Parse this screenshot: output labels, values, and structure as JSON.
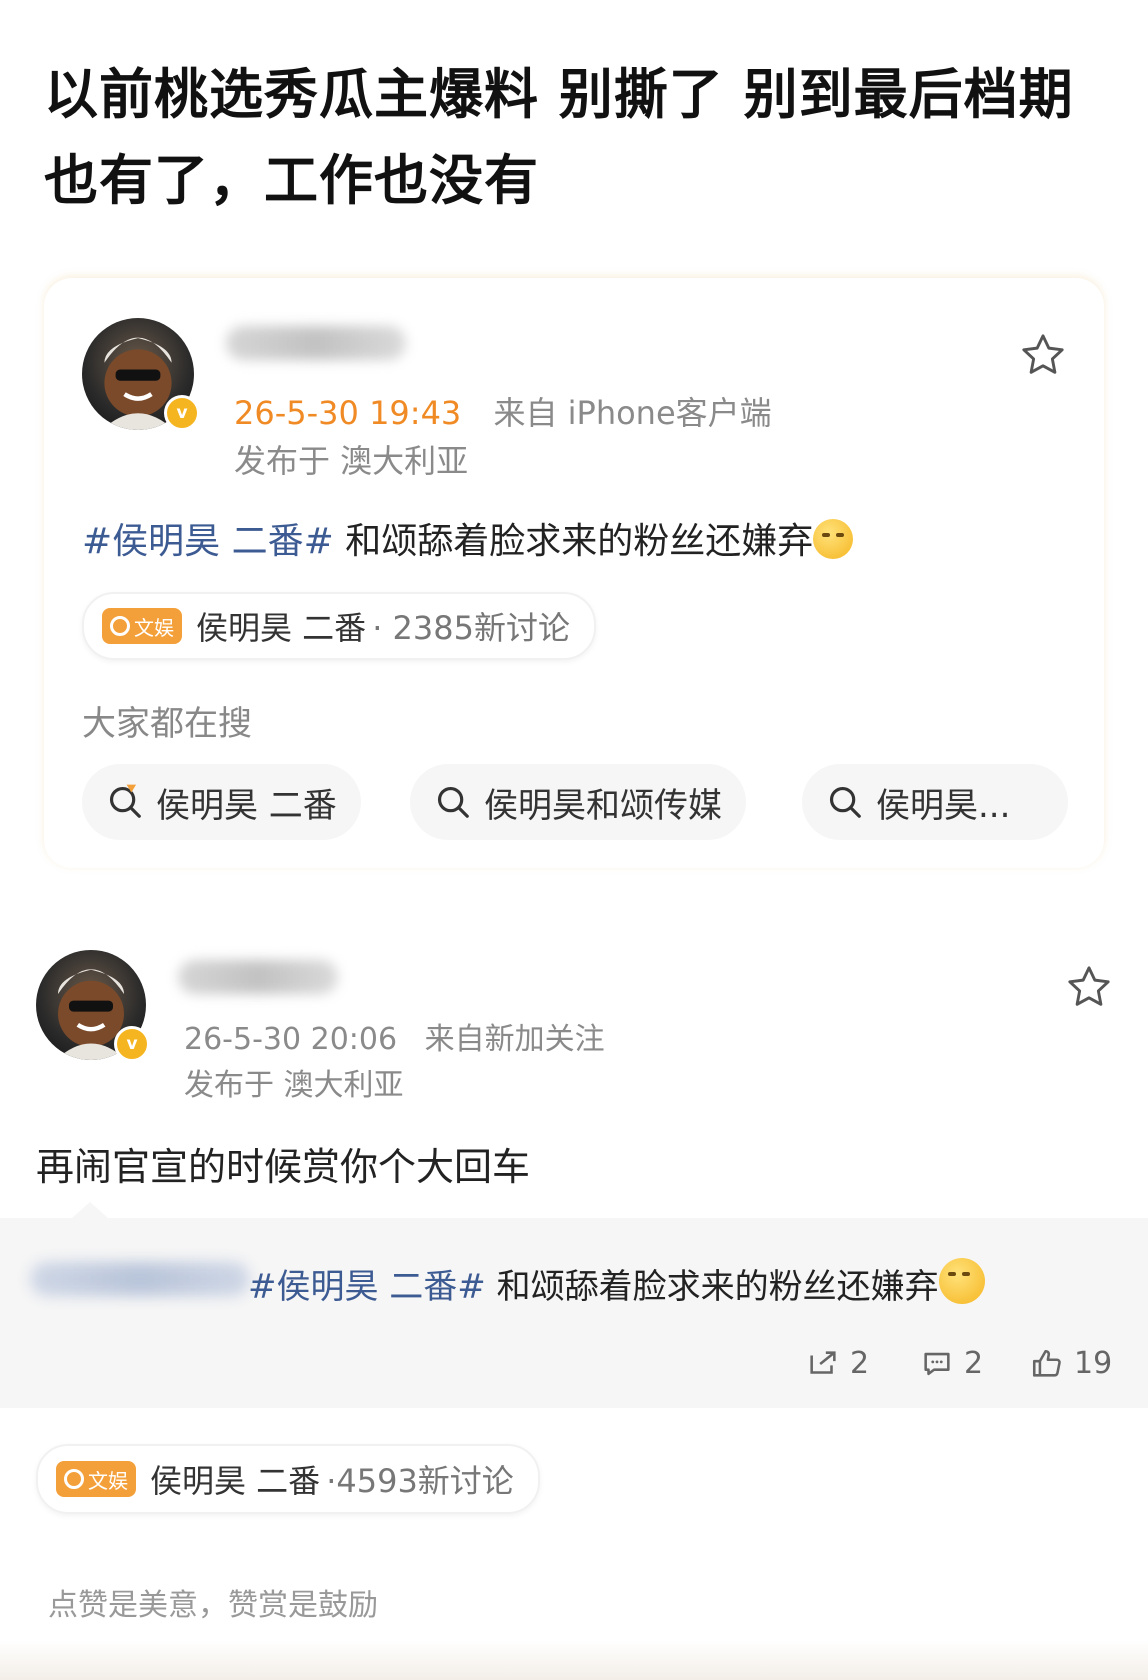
{
  "headline": "以前桃选秀瓜主爆料 别撕了 别到最后档期也有了，工作也没有",
  "post1": {
    "time": "26-5-30 19:43",
    "source": "来自 iPhone客户端",
    "location": "发布于 澳大利亚",
    "hashtag": "#侯明昊 二番#",
    "text": " 和颂舔着脸求来的粉丝还嫌弃",
    "topic": {
      "badge": "文娱",
      "name": "侯明昊 二番",
      "count": "· 2385新讨论"
    },
    "search_label": "大家都在搜",
    "chips": [
      "侯明昊 二番",
      "侯明昊和颂传媒",
      "侯明昊..."
    ]
  },
  "post2": {
    "time": "26-5-30 20:06",
    "source": "来自新加关注",
    "location": "发布于 澳大利亚",
    "text": "再闹官宣的时候赏你个大回车",
    "quoted": {
      "hashtag": "#侯明昊 二番#",
      "text": " 和颂舔着脸求来的粉丝还嫌弃",
      "reposts": "2",
      "comments": "2",
      "likes": "19"
    },
    "topic": {
      "badge": "文娱",
      "name": "侯明昊 二番",
      "count": "·4593新讨论"
    },
    "footer": "点赞是美意，赞赏是鼓励"
  },
  "colors": {
    "accent_orange": "#f08a24",
    "hashtag_blue": "#3d5b93",
    "badge_gold": "#f5b521"
  },
  "icons": [
    "star-icon",
    "search-icon",
    "hot-search-icon",
    "repost-icon",
    "comment-icon",
    "like-icon",
    "verified-badge-icon"
  ]
}
